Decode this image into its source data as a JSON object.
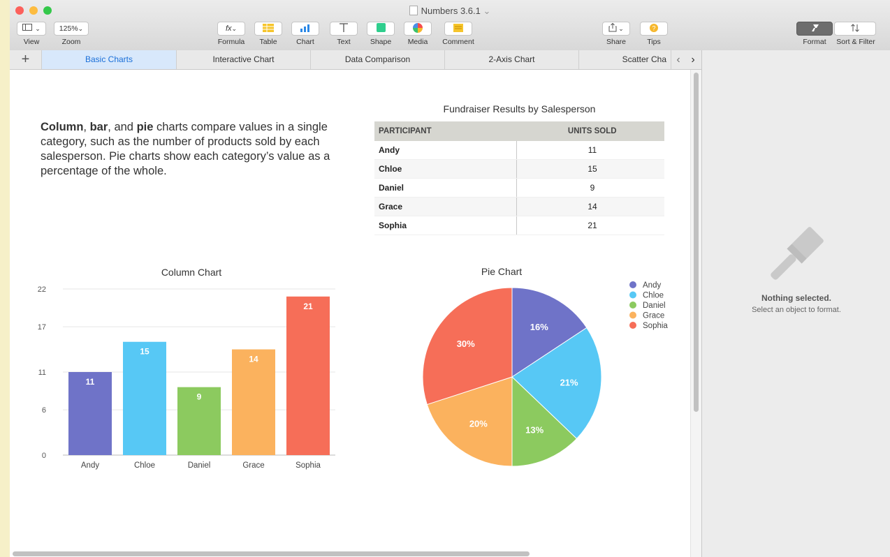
{
  "window": {
    "title": "Numbers 3.6.1",
    "title_suffix": "⌄",
    "traffic_colors": [
      "#fc605c",
      "#fdbc40",
      "#34c84a"
    ]
  },
  "toolbar": {
    "view_label": "View",
    "zoom_value": "125%",
    "zoom_label": "Zoom",
    "formula_icon": "fx",
    "formula_label": "Formula",
    "table_label": "Table",
    "chart_label": "Chart",
    "text_label": "Text",
    "shape_label": "Shape",
    "media_label": "Media",
    "comment_label": "Comment",
    "share_label": "Share",
    "tips_label": "Tips",
    "format_label": "Format",
    "sort_label": "Sort & Filter"
  },
  "tabs": [
    {
      "label": "Basic Charts",
      "active": true
    },
    {
      "label": "Interactive Chart"
    },
    {
      "label": "Data Comparison"
    },
    {
      "label": "2-Axis Chart"
    },
    {
      "label": "Scatter Cha"
    }
  ],
  "description": {
    "b1": "Column",
    "t1": ", ",
    "b2": "bar",
    "t2": ", and ",
    "b3": "pie",
    "t3": " charts compare values in a single category, such as the number of products sold by each salesperson. Pie charts show each category’s value as a percentage of the whole."
  },
  "table": {
    "title": "Fundraiser Results by Salesperson",
    "headers": [
      "PARTICIPANT",
      "UNITS SOLD"
    ],
    "rows": [
      {
        "name": "Andy",
        "units": "11"
      },
      {
        "name": "Chloe",
        "units": "15"
      },
      {
        "name": "Daniel",
        "units": "9"
      },
      {
        "name": "Grace",
        "units": "14"
      },
      {
        "name": "Sophia",
        "units": "21"
      }
    ]
  },
  "sidebar": {
    "title": "Nothing selected.",
    "subtitle": "Select an object to format."
  },
  "colors": {
    "andy": "#6f73c8",
    "chloe": "#57c8f5",
    "daniel": "#8cca5f",
    "grace": "#fbb25e",
    "sophia": "#f66e58"
  },
  "chart_data": [
    {
      "type": "bar",
      "title": "Column Chart",
      "categories": [
        "Andy",
        "Chloe",
        "Daniel",
        "Grace",
        "Sophia"
      ],
      "values": [
        11,
        15,
        9,
        14,
        21
      ],
      "data_labels": [
        "11",
        "15",
        "9",
        "14",
        "21"
      ],
      "yticks": [
        "0",
        "6",
        "11",
        "17",
        "22"
      ],
      "ylim": [
        0,
        22
      ],
      "grid": true,
      "xlabel": "",
      "ylabel": ""
    },
    {
      "type": "pie",
      "title": "Pie Chart",
      "categories": [
        "Andy",
        "Chloe",
        "Daniel",
        "Grace",
        "Sophia"
      ],
      "values": [
        11,
        15,
        9,
        14,
        21
      ],
      "data_labels": [
        "16%",
        "21%",
        "13%",
        "20%",
        "30%"
      ],
      "legend_position": "top-right"
    }
  ]
}
